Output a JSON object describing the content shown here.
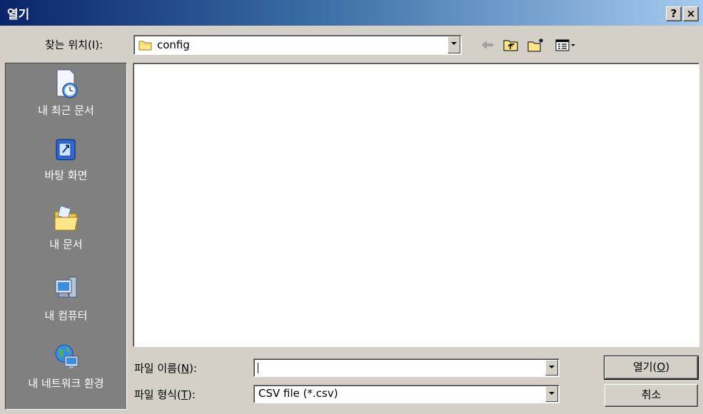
{
  "window": {
    "title": "열기",
    "help_label": "?",
    "close_label": "×"
  },
  "look_in": {
    "label": "찾는 위치(I):",
    "value": "config"
  },
  "toolbar": {
    "icons": [
      "back-arrow-icon",
      "up-folder-icon",
      "new-folder-icon",
      "view-menu-icon"
    ]
  },
  "places": [
    {
      "label": "내 최근 문서",
      "icon": "recent-documents-icon"
    },
    {
      "label": "바탕 화면",
      "icon": "desktop-icon"
    },
    {
      "label": "내 문서",
      "icon": "my-documents-icon"
    },
    {
      "label": "내 컴퓨터",
      "icon": "my-computer-icon"
    },
    {
      "label": "내 네트워크 환경",
      "icon": "network-icon"
    }
  ],
  "file_name": {
    "label_pre": "파일 이름(",
    "label_key": "N",
    "label_post": "):",
    "value": ""
  },
  "file_type": {
    "label_pre": "파일 형식(",
    "label_key": "T",
    "label_post": "):",
    "value": "CSV file (*.csv)"
  },
  "buttons": {
    "open_pre": "열기(",
    "open_key": "O",
    "open_post": ")",
    "cancel": "취소"
  },
  "colors": {
    "title_start": "#0a246a",
    "title_end": "#a6caf0",
    "dialog_bg": "#d4d0c8",
    "places_bg": "#808080"
  }
}
